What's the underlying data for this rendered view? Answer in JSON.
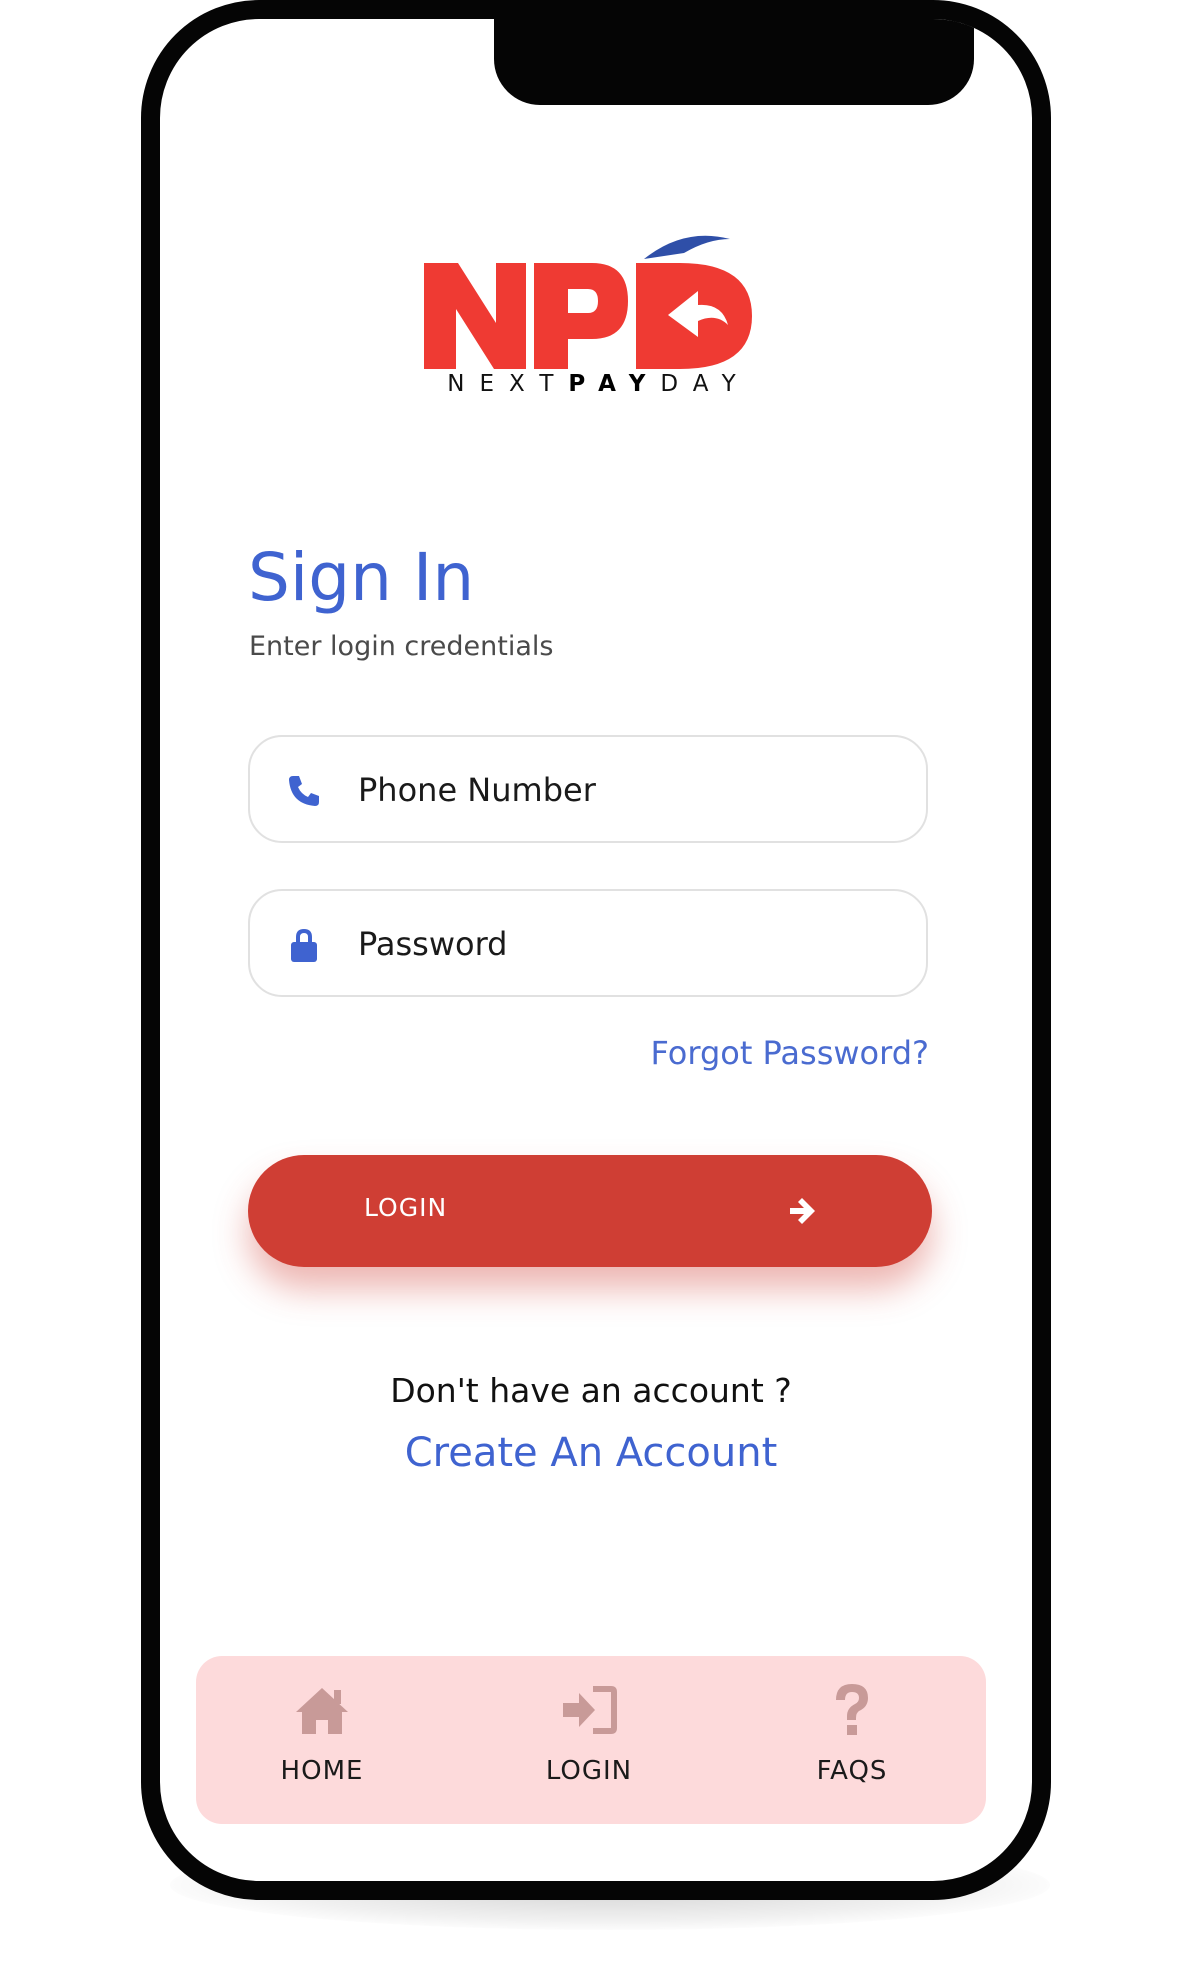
{
  "brand": {
    "logo_letters": "NPD",
    "wordmark_left": "NEXT",
    "wordmark_mid": "PAY",
    "wordmark_right": "DAY",
    "colors": {
      "red": "#ef3a33",
      "blue": "#2f4fa8"
    }
  },
  "signin": {
    "title": "Sign In",
    "subtitle": "Enter login credentials"
  },
  "form": {
    "phone": {
      "placeholder": "Phone Number",
      "value": "",
      "icon": "phone-icon"
    },
    "password": {
      "placeholder": "Password",
      "value": "",
      "icon": "lock-icon"
    },
    "forgot_label": "Forgot Password?",
    "login_label": "LOGIN",
    "login_icon": "arrow-right-icon"
  },
  "signup": {
    "prompt": "Don't have an account ?",
    "link": "Create An Account"
  },
  "nav": {
    "items": [
      {
        "label": "HOME",
        "icon": "home-icon"
      },
      {
        "label": "LOGIN",
        "icon": "sign-in-icon"
      },
      {
        "label": "FAQS",
        "icon": "question-icon"
      }
    ]
  },
  "colors": {
    "accent_blue": "#3f63d0",
    "button_red": "#cf3e34",
    "nav_background": "#fddadb",
    "nav_icon": "#c89a98"
  }
}
